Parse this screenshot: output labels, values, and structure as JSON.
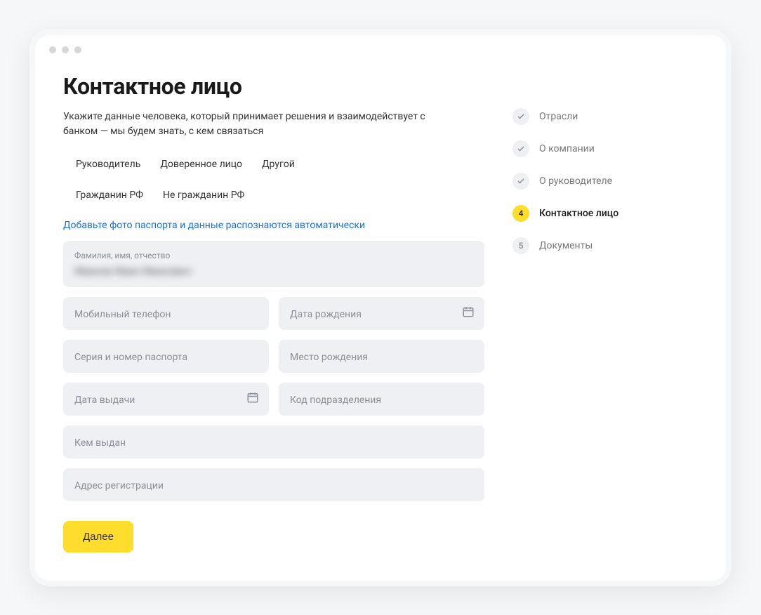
{
  "header": {
    "title": "Контактное лицо",
    "subtitle": "Укажите данные человека, который принимает решения и взаимодействует с банком — мы будем знать, с кем связаться"
  },
  "role_tabs": [
    "Руководитель",
    "Доверенное лицо",
    "Другой"
  ],
  "citizen_tabs": [
    "Гражданин РФ",
    "Не гражданин РФ"
  ],
  "passport_link": "Добавьте фото паспорта и данные распознаются автоматически",
  "fields": {
    "fio_label": "Фамилия, имя, отчество",
    "fio_value": "Иванов Иван Иванович",
    "phone": "Мобильный телефон",
    "birthdate": "Дата рождения",
    "passport_sn": "Серия и номер паспорта",
    "birthplace": "Место рождения",
    "issue_date": "Дата выдачи",
    "dept_code": "Код подразделения",
    "issued_by": "Кем выдан",
    "reg_address": "Адрес регистрации"
  },
  "buttons": {
    "next": "Далее"
  },
  "steps": [
    {
      "label": "Отрасли",
      "state": "done"
    },
    {
      "label": "О компании",
      "state": "done"
    },
    {
      "label": "О руководителе",
      "state": "done"
    },
    {
      "label": "Контактное лицо",
      "state": "active",
      "num": "4"
    },
    {
      "label": "Документы",
      "state": "todo",
      "num": "5"
    }
  ]
}
